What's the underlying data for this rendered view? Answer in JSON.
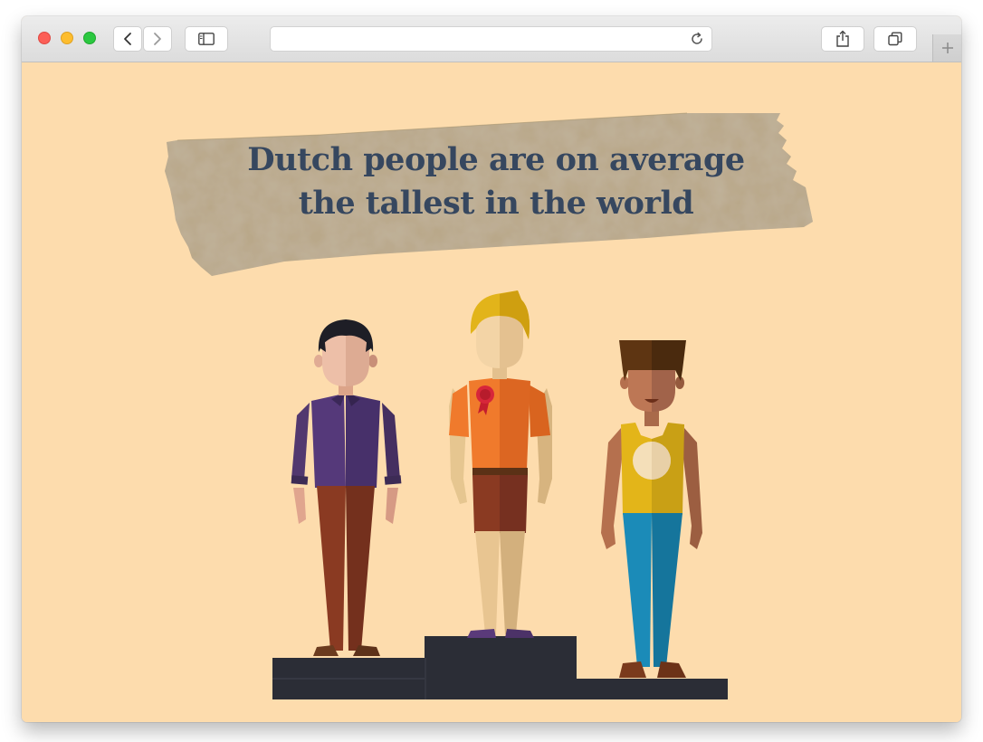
{
  "browser": {
    "url": "",
    "buttons": {
      "back": "chevron-left-icon",
      "forward": "chevron-right-icon",
      "sidebar": "sidebar-icon",
      "reload": "reload-icon",
      "share": "share-icon",
      "tabs": "tabs-icon",
      "new_tab": "plus-icon"
    },
    "colors": {
      "close": "#fc5f57",
      "minimize": "#fdbd2e",
      "zoom": "#2bc840"
    }
  },
  "page": {
    "headline_line1": "Dutch people are on average",
    "headline_line2": "the tallest in the world",
    "colors": {
      "background": "#fddcad",
      "headline": "#36475f",
      "podium": "#2b2d36"
    }
  }
}
